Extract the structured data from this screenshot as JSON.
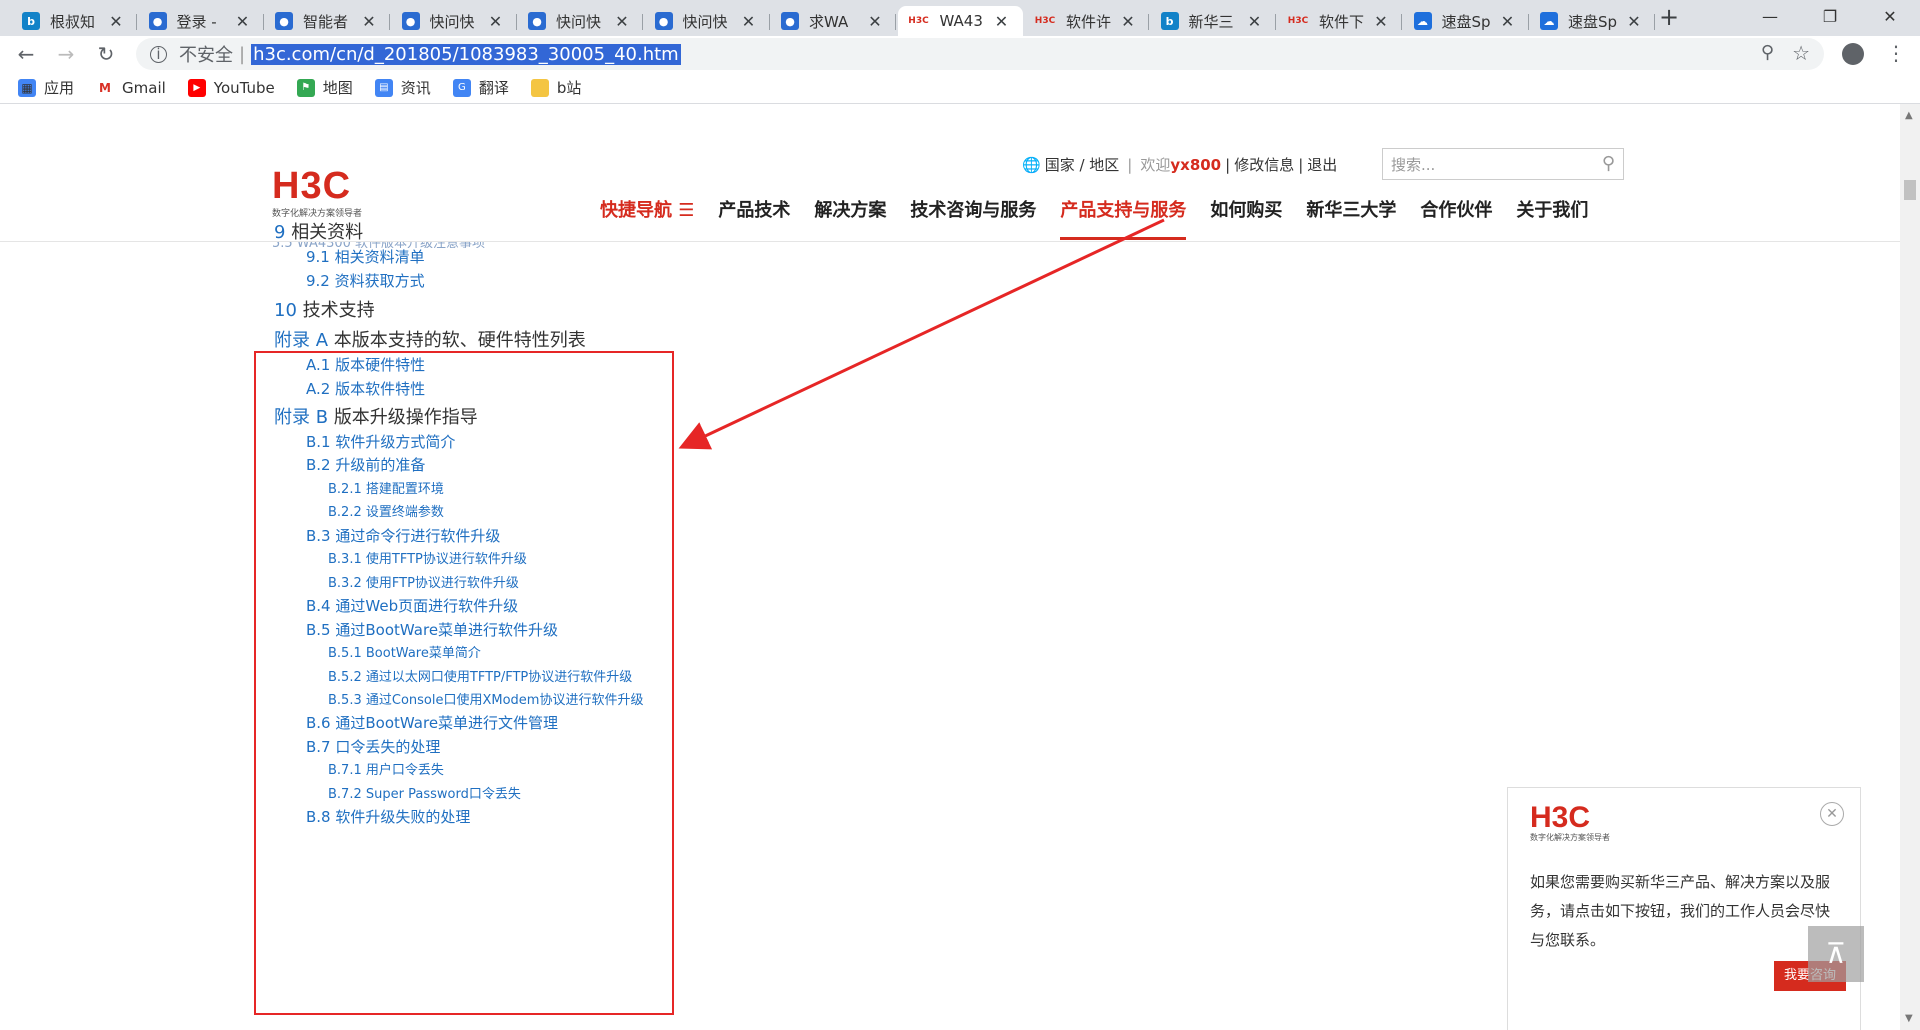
{
  "browser": {
    "tabs": [
      {
        "label": "根叔知",
        "favicon": "bing"
      },
      {
        "label": "登录 -",
        "favicon": "doc"
      },
      {
        "label": "智能者",
        "favicon": "doc"
      },
      {
        "label": "快问快",
        "favicon": "doc"
      },
      {
        "label": "快问快",
        "favicon": "doc"
      },
      {
        "label": "快问快",
        "favicon": "doc"
      },
      {
        "label": "求WA",
        "favicon": "doc"
      },
      {
        "label": "WA43",
        "favicon": "h3c"
      },
      {
        "label": "软件许",
        "favicon": "h3c"
      },
      {
        "label": "新华三",
        "favicon": "bing"
      },
      {
        "label": "软件下",
        "favicon": "h3c"
      },
      {
        "label": "速盘Sp",
        "favicon": "cloud"
      },
      {
        "label": "速盘Sp",
        "favicon": "cloud"
      }
    ],
    "active_tab_index": 7,
    "new_tab_glyph": "+",
    "security_label": "不安全",
    "url": "h3c.com/cn/d_201805/1083983_30005_40.htm",
    "bookmarks": [
      {
        "label": "应用",
        "icon": "apps-grid-icon"
      },
      {
        "label": "Gmail",
        "icon": "gmail-icon"
      },
      {
        "label": "YouTube",
        "icon": "youtube-icon"
      },
      {
        "label": "地图",
        "icon": "maps-icon"
      },
      {
        "label": "资讯",
        "icon": "news-icon"
      },
      {
        "label": "翻译",
        "icon": "translate-icon"
      },
      {
        "label": "b站",
        "icon": "folder-icon"
      }
    ]
  },
  "site": {
    "logo_text": "H3C",
    "logo_tagline": "数字化解决方案领导者",
    "util": {
      "region": "国家 / 地区",
      "welcome": "欢迎",
      "username": "yx800",
      "edit_info": "修改信息",
      "logout": "退出"
    },
    "search_placeholder": "搜索...",
    "nav": [
      {
        "label": "快捷导航 ☰",
        "style": "red"
      },
      {
        "label": "产品技术",
        "style": "normal"
      },
      {
        "label": "解决方案",
        "style": "normal"
      },
      {
        "label": "技术咨询与服务",
        "style": "normal"
      },
      {
        "label": "产品支持与服务",
        "style": "active"
      },
      {
        "label": "如何购买",
        "style": "normal"
      },
      {
        "label": "新华三大学",
        "style": "normal"
      },
      {
        "label": "合作伙伴",
        "style": "normal"
      },
      {
        "label": "关于我们",
        "style": "normal"
      }
    ]
  },
  "toc": [
    {
      "num": "9",
      "text": "相关资料",
      "level": 1
    },
    {
      "num": "9.1",
      "text": "相关资料清单",
      "level": 2
    },
    {
      "num": "9.2",
      "text": "资料获取方式",
      "level": 2
    },
    {
      "num": "10",
      "text": "技术支持",
      "level": 1
    },
    {
      "num": "附录 A",
      "text": "本版本支持的软、硬件特性列表",
      "level": 1
    },
    {
      "num": "A.1",
      "text": "版本硬件特性",
      "level": 2
    },
    {
      "num": "A.2",
      "text": "版本软件特性",
      "level": 2
    },
    {
      "num": "附录 B",
      "text": "版本升级操作指导",
      "level": 1
    },
    {
      "num": "B.1",
      "text": "软件升级方式简介",
      "level": 2
    },
    {
      "num": "B.2",
      "text": "升级前的准备",
      "level": 2
    },
    {
      "num": "B.2.1",
      "text": "搭建配置环境",
      "level": 3
    },
    {
      "num": "B.2.2",
      "text": "设置终端参数",
      "level": 3
    },
    {
      "num": "B.3",
      "text": "通过命令行进行软件升级",
      "level": 2
    },
    {
      "num": "B.3.1",
      "text": "使用TFTP协议进行软件升级",
      "level": 3
    },
    {
      "num": "B.3.2",
      "text": "使用FTP协议进行软件升级",
      "level": 3
    },
    {
      "num": "B.4",
      "text": "通过Web页面进行软件升级",
      "level": 2
    },
    {
      "num": "B.5",
      "text": "通过BootWare菜单进行软件升级",
      "level": 2
    },
    {
      "num": "B.5.1",
      "text": "BootWare菜单简介",
      "level": 3
    },
    {
      "num": "B.5.2",
      "text": "通过以太网口使用TFTP/FTP协议进行软件升级",
      "level": 3
    },
    {
      "num": "B.5.3",
      "text": "通过Console口使用XModem协议进行软件升级",
      "level": 3
    },
    {
      "num": "B.6",
      "text": "通过BootWare菜单进行文件管理",
      "level": 2
    },
    {
      "num": "B.7",
      "text": "口令丢失的处理",
      "level": 2
    },
    {
      "num": "B.7.1",
      "text": "用户口令丢失",
      "level": 3
    },
    {
      "num": "B.7.2",
      "text": "Super Password口令丢失",
      "level": 3
    },
    {
      "num": "B.8",
      "text": "软件升级失败的处理",
      "level": 2
    }
  ],
  "popup": {
    "logo_text": "H3C",
    "logo_tagline": "数字化解决方案领导者",
    "message": "如果您需要购买新华三产品、解决方案以及服务，请点击如下按钮，我们的工作人员会尽快与您联系。",
    "button_label": "我要咨询"
  },
  "colors": {
    "brand_red": "#d52b1e",
    "link_blue": "#1f6fc1",
    "annotation_red": "#e62626"
  }
}
